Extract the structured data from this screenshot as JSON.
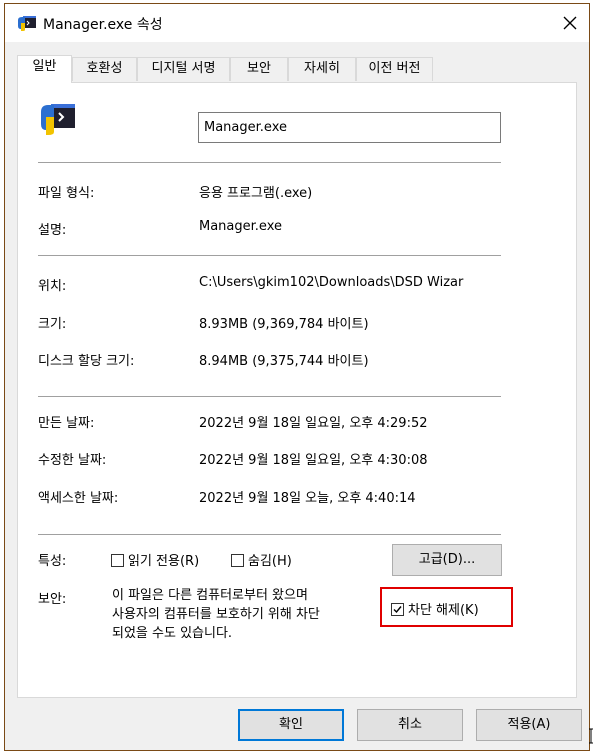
{
  "window": {
    "title": "Manager.exe 속성",
    "close_label": "×"
  },
  "tabs": [
    {
      "label": "일반",
      "active": true
    },
    {
      "label": "호환성"
    },
    {
      "label": "디지털 서명"
    },
    {
      "label": "보안"
    },
    {
      "label": "자세히"
    },
    {
      "label": "이전 버전"
    }
  ],
  "general": {
    "file_name": "Manager.exe",
    "rows": {
      "file_type": {
        "label": "파일 형식:",
        "value": "응용 프로그램(.exe)"
      },
      "description": {
        "label": "설명:",
        "value": "Manager.exe"
      },
      "location": {
        "label": "위치:",
        "value": "C:\\Users\\gkim102\\Downloads\\DSD Wizar"
      },
      "size": {
        "label": "크기:",
        "value": "8.93MB (9,369,784 바이트)"
      },
      "size_on_disk": {
        "label": "디스크 할당 크기:",
        "value": "8.94MB (9,375,744 바이트)"
      },
      "created": {
        "label": "만든 날짜:",
        "value": "2022년 9월 18일 일요일, 오후 4:29:52"
      },
      "modified": {
        "label": "수정한 날짜:",
        "value": "2022년 9월 18일 일요일, 오후 4:30:08"
      },
      "accessed": {
        "label": "액세스한 날짜:",
        "value": "2022년 9월 18일 오늘, 오후 4:40:14"
      }
    },
    "attributes": {
      "label": "특성:",
      "readonly": {
        "label": "읽기 전용(R)",
        "checked": false
      },
      "hidden": {
        "label": "숨김(H)",
        "checked": false
      },
      "advanced_button": "고급(D)..."
    },
    "security": {
      "label": "보안:",
      "message_line1": "이 파일은 다른 컴퓨터로부터 왔으며",
      "message_line2": "사용자의 컴퓨터를 보호하기 위해 차단",
      "message_line3": "되었을 수도 있습니다.",
      "unblock": {
        "label": "차단 해제(K)",
        "checked": true
      },
      "highlight_color": "#e00000"
    }
  },
  "footer": {
    "ok": "확인",
    "cancel": "취소",
    "apply": "적용(A)"
  },
  "icons": {
    "title_icon": "exe-file-icon",
    "file_icon": "exe-file-icon",
    "close": "close-icon"
  },
  "colors": {
    "window_border": "#7a4a16",
    "focus_blue": "#0078d7"
  }
}
